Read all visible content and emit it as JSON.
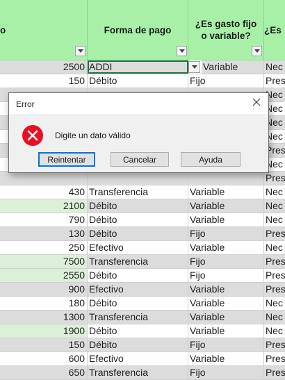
{
  "header": {
    "col0": "o",
    "col1": "Forma de pago",
    "col2_line1": "¿Es gasto fijo",
    "col2_line2": "o variable?",
    "col3": "¿Es"
  },
  "rows": [
    {
      "amount": "2500",
      "payment": "ADDI",
      "type": "Variable",
      "cat": "Nec"
    },
    {
      "amount": "150",
      "payment": "Débito",
      "type": "Fijo",
      "cat": "Pres"
    },
    {
      "amount": "",
      "payment": "",
      "type": "",
      "cat": "Nec"
    },
    {
      "amount": "",
      "payment": "",
      "type": "",
      "cat": "Nec"
    },
    {
      "amount": "",
      "payment": "",
      "type": "",
      "cat": "Nec"
    },
    {
      "amount": "",
      "payment": "",
      "type": "",
      "cat": "Nec"
    },
    {
      "amount": "",
      "payment": "",
      "type": "",
      "cat": "Pres"
    },
    {
      "amount": "",
      "payment": "",
      "type": "",
      "cat": "Nec"
    },
    {
      "amount": "",
      "payment": "",
      "type": "",
      "cat": "Pres"
    },
    {
      "amount": "430",
      "payment": "Transferencia",
      "type": "Variable",
      "cat": "Nec"
    },
    {
      "amount": "2100",
      "payment": "Débito",
      "type": "Variable",
      "cat": "Nec"
    },
    {
      "amount": "790",
      "payment": "Débito",
      "type": "Variable",
      "cat": "Nec"
    },
    {
      "amount": "130",
      "payment": "Débito",
      "type": "Fijo",
      "cat": "Pres"
    },
    {
      "amount": "250",
      "payment": "Efectivo",
      "type": "Variable",
      "cat": "Nec"
    },
    {
      "amount": "7500",
      "payment": "Transferencia",
      "type": "Fijo",
      "cat": "Pres"
    },
    {
      "amount": "2550",
      "payment": "Débito",
      "type": "Fijo",
      "cat": "Pres"
    },
    {
      "amount": "900",
      "payment": "Efectivo",
      "type": "Variable",
      "cat": "Pres"
    },
    {
      "amount": "180",
      "payment": "Débito",
      "type": "Variable",
      "cat": "Nec"
    },
    {
      "amount": "1300",
      "payment": "Transferencia",
      "type": "Variable",
      "cat": "Nec"
    },
    {
      "amount": "1900",
      "payment": "Débito",
      "type": "Variable",
      "cat": "Nec"
    },
    {
      "amount": "150",
      "payment": "Débito",
      "type": "Fijo",
      "cat": "Pres"
    },
    {
      "amount": "600",
      "payment": "Efectivo",
      "type": "Variable",
      "cat": "Pres"
    },
    {
      "amount": "650",
      "payment": "Transferencia",
      "type": "Fijo",
      "cat": "Pres"
    }
  ],
  "dialog": {
    "title": "Error",
    "message": "Digite un dato válido",
    "retry_label": "Reintentar",
    "cancel_label": "Cancelar",
    "help_label": "Ayuda",
    "icon": "error-icon"
  },
  "colors": {
    "header_bg": "#a8f0a8",
    "row_shade": "#dcdcdc",
    "amount_highlight": "#dcefd8",
    "selection": "#217346",
    "error_red": "#e81123"
  }
}
